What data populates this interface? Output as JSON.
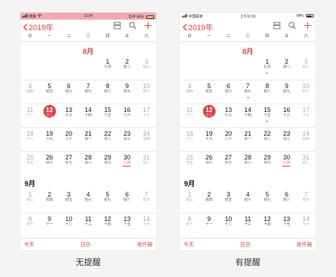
{
  "colors": {
    "accent": "#e8413f",
    "statusbar_left_bg": "#f4a8ad"
  },
  "phones": [
    {
      "status": {
        "left": "搜索",
        "time": "11:34",
        "battery": "86%"
      },
      "caption": "无提醒",
      "has_dots": false
    },
    {
      "status": {
        "left": "中国联通",
        "time": "上午11:33",
        "battery": "68%"
      },
      "caption": "有提醒",
      "has_dots": true
    }
  ],
  "nav": {
    "back_label": "2019年",
    "icons": [
      "inbox-icon",
      "search-icon",
      "add-icon"
    ]
  },
  "weekdays": [
    "日",
    "一",
    "二",
    "三",
    "四",
    "五",
    "六"
  ],
  "months": [
    {
      "label": "8月",
      "style": "aug",
      "weeks": [
        [
          null,
          null,
          null,
          null,
          {
            "d": "1",
            "l": "七月",
            "dot": true
          },
          {
            "d": "2",
            "l": "初二"
          },
          {
            "d": "3",
            "l": "初三"
          }
        ],
        [
          {
            "d": "4",
            "l": "初四"
          },
          {
            "d": "5",
            "l": "初五"
          },
          {
            "d": "6",
            "l": "初六"
          },
          {
            "d": "7",
            "l": "初七",
            "dot": true
          },
          {
            "d": "8",
            "l": "初八"
          },
          {
            "d": "9",
            "l": "初九"
          },
          {
            "d": "10",
            "l": "初十"
          }
        ],
        [
          {
            "d": "11",
            "l": "十一"
          },
          {
            "d": "12",
            "l": "十二",
            "today": true
          },
          {
            "d": "13",
            "l": "十三"
          },
          {
            "d": "14",
            "l": "十四"
          },
          {
            "d": "15",
            "l": "十五",
            "dot": true
          },
          {
            "d": "16",
            "l": "十六"
          },
          {
            "d": "17",
            "l": "十七"
          }
        ],
        [
          {
            "d": "18",
            "l": "十八"
          },
          {
            "d": "19",
            "l": "十九"
          },
          {
            "d": "20",
            "l": "二十"
          },
          {
            "d": "21",
            "l": "廿一"
          },
          {
            "d": "22",
            "l": "廿二"
          },
          {
            "d": "23",
            "l": "廿三"
          },
          {
            "d": "24",
            "l": "廿四"
          }
        ],
        [
          {
            "d": "25",
            "l": "廿五"
          },
          {
            "d": "26",
            "l": "廿六"
          },
          {
            "d": "27",
            "l": "廿七"
          },
          {
            "d": "28",
            "l": "廿八"
          },
          {
            "d": "29",
            "l": "廿九"
          },
          {
            "d": "30",
            "l": "八月",
            "festival": true
          },
          {
            "d": "31",
            "l": "初二"
          }
        ]
      ]
    },
    {
      "label": "9月",
      "style": "sep",
      "weeks": [
        [
          {
            "d": "1",
            "l": "初三"
          },
          {
            "d": "2",
            "l": "初四"
          },
          {
            "d": "3",
            "l": "初五"
          },
          {
            "d": "4",
            "l": "初六"
          },
          {
            "d": "5",
            "l": "初七"
          },
          {
            "d": "6",
            "l": "初八"
          },
          {
            "d": "7",
            "l": "初九"
          }
        ],
        [
          {
            "d": "8",
            "l": "初十"
          },
          {
            "d": "9",
            "l": "十一"
          },
          {
            "d": "10",
            "l": "十二"
          },
          {
            "d": "11",
            "l": "十三"
          },
          {
            "d": "12",
            "l": "十四"
          },
          {
            "d": "13",
            "l": "十五"
          },
          {
            "d": "14",
            "l": "十六"
          }
        ]
      ]
    }
  ],
  "tabbar": {
    "today": "今天",
    "calendars": "日历",
    "inbox": "收件箱"
  }
}
